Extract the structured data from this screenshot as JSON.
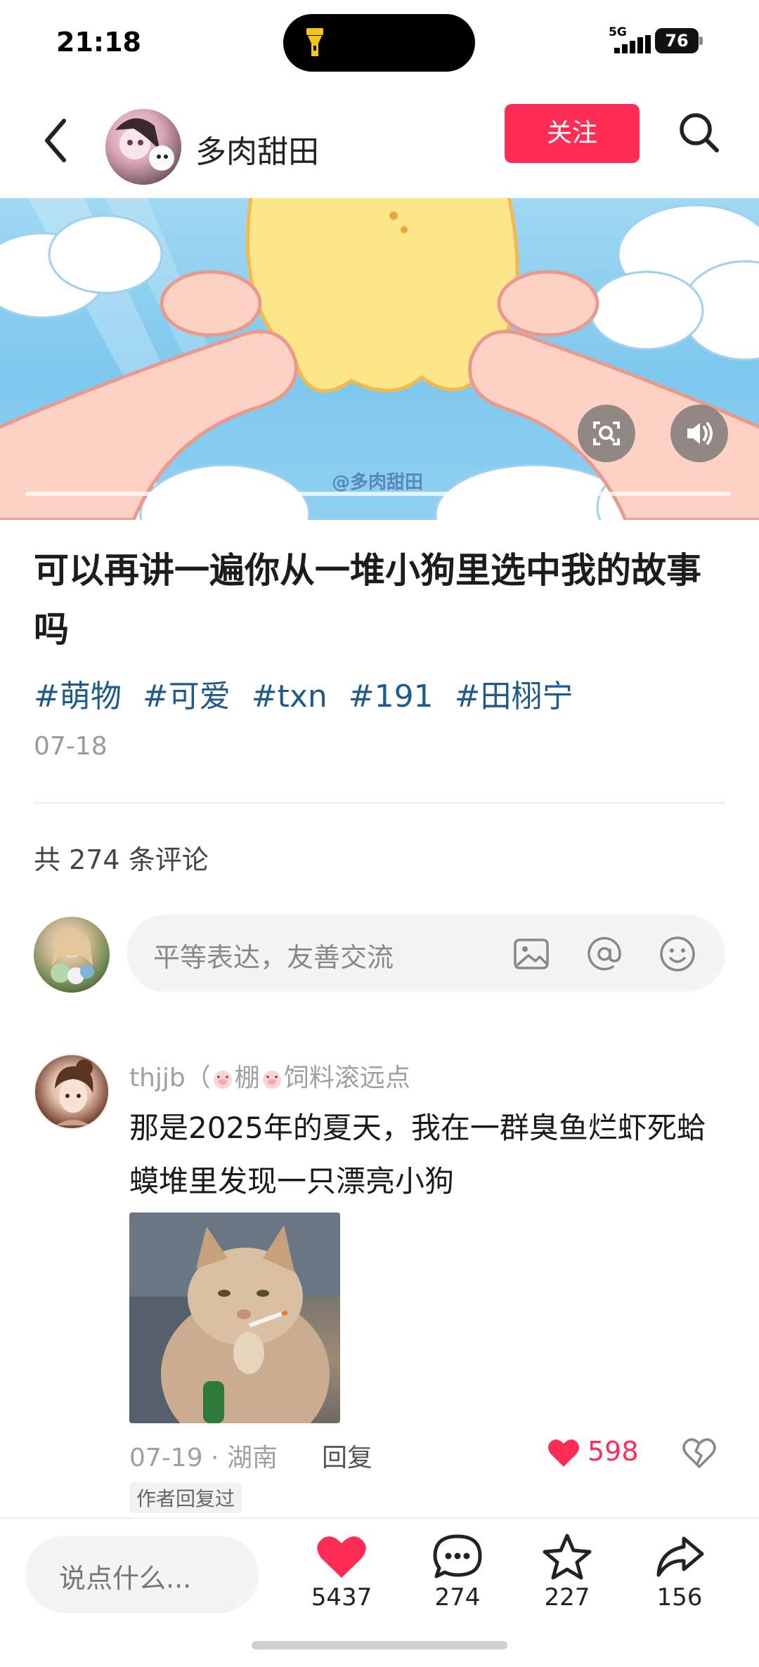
{
  "status_bar": {
    "time": "21:18",
    "network": "5G",
    "battery": "76"
  },
  "header": {
    "author_name": "多肉甜田",
    "follow_label": "关注"
  },
  "media": {
    "watermark": "@多肉甜田"
  },
  "post": {
    "title": "可以再讲一遍你从一堆小狗里选中我的故事吗",
    "tags": [
      "#萌物",
      "#可爱",
      "#txn",
      "#191",
      "#田栩宁"
    ],
    "date": "07-18"
  },
  "comments_header": "共 274 条评论",
  "comment_input": {
    "placeholder": "平等表达，友善交流"
  },
  "comment": {
    "username_prefix": "thjjb（",
    "username_mid": "棚",
    "username_suffix": "饲料滚远点",
    "text": "那是2025年的夏天，我在一群臭鱼烂虾死蛤蟆堆里发现一只漂亮小狗",
    "meta": "07-19 · 湖南",
    "reply_label": "回复",
    "likes": "598",
    "badge": "作者回复过"
  },
  "bottom_bar": {
    "input_placeholder": "说点什么...",
    "likes": "5437",
    "comments": "274",
    "favorites": "227",
    "shares": "156"
  },
  "colors": {
    "accent": "#ff2d55",
    "tag": "#1f5a8c",
    "muted": "#a0a0a0"
  }
}
